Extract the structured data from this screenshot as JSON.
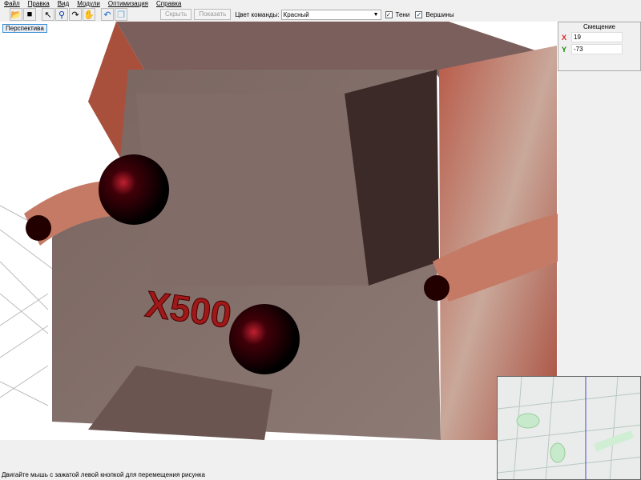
{
  "menu": [
    "Файл",
    "Правка",
    "Вид",
    "Модули",
    "Оптимизация",
    "Справка"
  ],
  "toolbar": {
    "hide": "Скрыть",
    "show": "Показать",
    "team_color_label": "Цвет команды:",
    "team_color_value": "Красный",
    "shadows": "Тени",
    "vertices": "Вершины"
  },
  "viewport": {
    "mode_button": "Перспектива",
    "logo": "X500"
  },
  "offset": {
    "title": "Смещение",
    "x_label": "X",
    "x_value": "19",
    "y_label": "Y",
    "y_value": "-73"
  },
  "status": "Двигайте мышь с зажатой левой кнопкой для перемещения  рисунка"
}
